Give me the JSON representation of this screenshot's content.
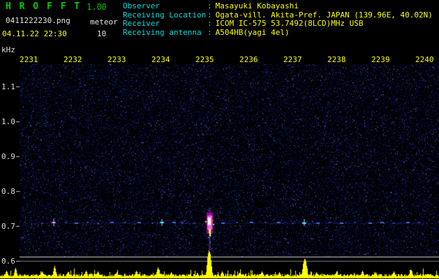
{
  "colors": {
    "background": "#000000",
    "title_green": "#00c800",
    "label_cyan": "#00dfdf",
    "value_yellow": "#ffff00",
    "axis_white": "#dcdcdc",
    "tick_yellow": "#ffff00",
    "level_trace_yellow": "#ffff00",
    "noise_blue": "#0000aa",
    "echo_core_white": "#ffffff",
    "echo_magenta": "#ff50f0",
    "echo_cyan": "#2fd8f2"
  },
  "header": {
    "title": "H R O F F T",
    "version": "1.00",
    "filename": "0411222230.png",
    "mode": "meteor",
    "count": "10",
    "timestamp": "04.11.22 22:30"
  },
  "info": {
    "colon": ":",
    "rows": [
      {
        "label": "Observer",
        "value": "Masayuki Kobayashi"
      },
      {
        "label": "Receiving Location",
        "value": "Ogata-vill. Akita-Pref. JAPAN (139.96E, 40.02N)"
      },
      {
        "label": "Receiver",
        "value": "ICOM IC-575 53.7492(8LCD)MHz USB"
      },
      {
        "label": "Receiving antenna",
        "value": "A504HB(yagi 4el)"
      }
    ]
  },
  "chart_data": {
    "type": "heatmap",
    "x_ticks": [
      "2231",
      "2232",
      "2233",
      "2234",
      "2235",
      "2236",
      "2237",
      "2238",
      "2239",
      "2240"
    ],
    "y_unit_label": "kHz",
    "y_ticks": [
      "1.1",
      "1.0",
      "0.9",
      "0.8",
      "0.7",
      "0.6"
    ],
    "y_range_khz": [
      0.55,
      1.16
    ],
    "echo_line_khz": 0.71,
    "meteor_count_shown": 10,
    "echoes": [
      {
        "t": 2231.51,
        "s": 1
      },
      {
        "t": 2231.79,
        "s": 4
      },
      {
        "t": 2232.06,
        "s": 1
      },
      {
        "t": 2232.3,
        "s": 2
      },
      {
        "t": 2232.54,
        "s": 1
      },
      {
        "t": 2232.78,
        "s": 1
      },
      {
        "t": 2233.1,
        "s": 2
      },
      {
        "t": 2233.41,
        "s": 1
      },
      {
        "t": 2233.73,
        "s": 2
      },
      {
        "t": 2234.02,
        "s": 1
      },
      {
        "t": 2234.24,
        "s": 3
      },
      {
        "t": 2234.52,
        "s": 2
      },
      {
        "t": 2234.71,
        "s": 1
      },
      {
        "t": 2234.97,
        "s": 1
      },
      {
        "t": 2235.32,
        "s": 5
      },
      {
        "t": 2235.63,
        "s": 2
      },
      {
        "t": 2235.95,
        "s": 1
      },
      {
        "t": 2236.27,
        "s": 2
      },
      {
        "t": 2236.59,
        "s": 1
      },
      {
        "t": 2236.9,
        "s": 2
      },
      {
        "t": 2237.22,
        "s": 1
      },
      {
        "t": 2237.49,
        "s": 3
      },
      {
        "t": 2237.78,
        "s": 2
      },
      {
        "t": 2238.05,
        "s": 1
      },
      {
        "t": 2238.33,
        "s": 2
      },
      {
        "t": 2238.62,
        "s": 1
      },
      {
        "t": 2238.97,
        "s": 2
      },
      {
        "t": 2239.25,
        "s": 2
      },
      {
        "t": 2239.52,
        "s": 1
      },
      {
        "t": 2239.84,
        "s": 2
      },
      {
        "t": 2240.08,
        "s": 1
      }
    ],
    "level_spikes": [
      {
        "t": 2230.7,
        "h": 9
      },
      {
        "t": 2230.9,
        "h": 13
      },
      {
        "t": 2231.5,
        "h": 8
      },
      {
        "t": 2231.79,
        "h": 16
      },
      {
        "t": 2232.1,
        "h": 7
      },
      {
        "t": 2232.5,
        "h": 9
      },
      {
        "t": 2232.78,
        "h": 8
      },
      {
        "t": 2233.2,
        "h": 7
      },
      {
        "t": 2233.65,
        "h": 9
      },
      {
        "t": 2234.15,
        "h": 14
      },
      {
        "t": 2234.45,
        "h": 7
      },
      {
        "t": 2235.32,
        "h": 38
      },
      {
        "t": 2235.6,
        "h": 8
      },
      {
        "t": 2236.0,
        "h": 6
      },
      {
        "t": 2236.5,
        "h": 8
      },
      {
        "t": 2236.9,
        "h": 7
      },
      {
        "t": 2237.49,
        "h": 26
      },
      {
        "t": 2237.75,
        "h": 7
      },
      {
        "t": 2238.2,
        "h": 8
      },
      {
        "t": 2238.8,
        "h": 9
      },
      {
        "t": 2239.1,
        "h": 7
      },
      {
        "t": 2239.5,
        "h": 8
      },
      {
        "t": 2239.9,
        "h": 10
      }
    ]
  }
}
